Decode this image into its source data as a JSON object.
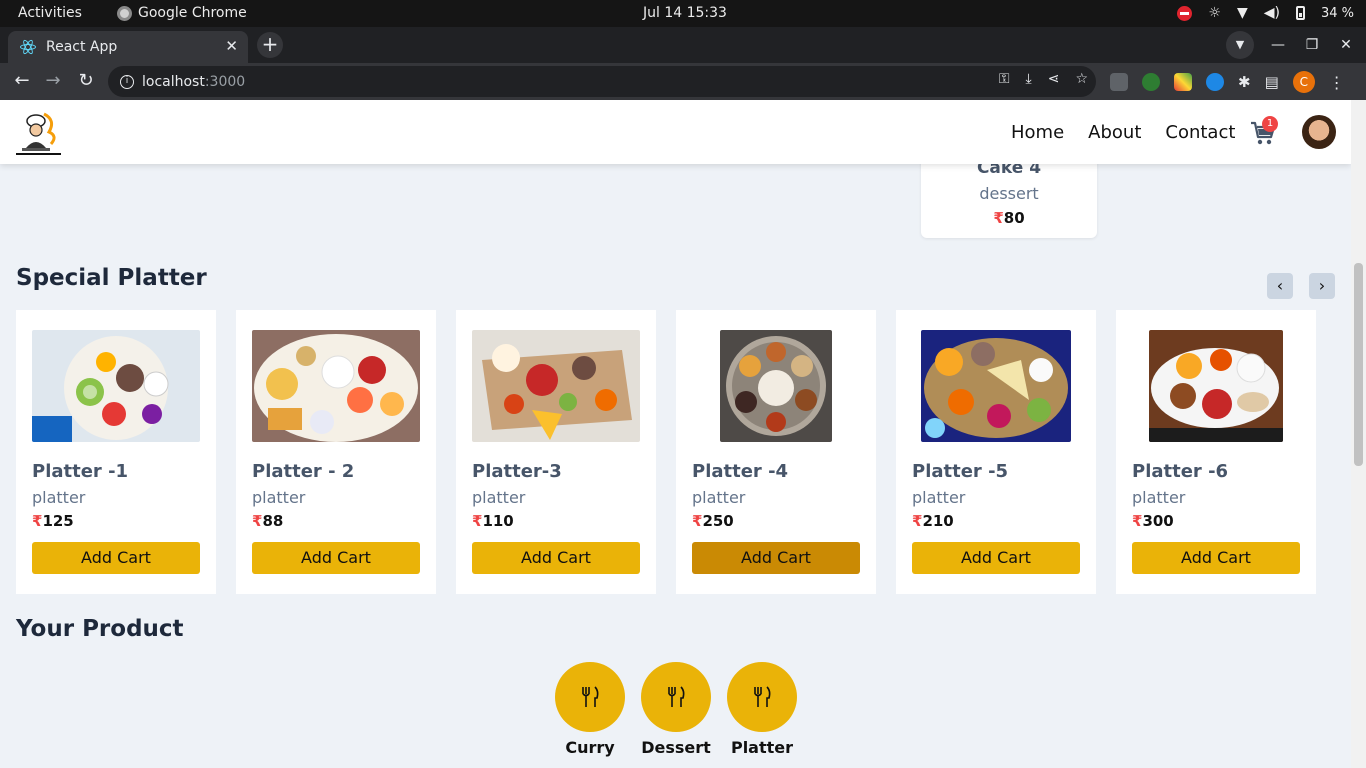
{
  "system_bar": {
    "activities": "Activities",
    "app_name": "Google Chrome",
    "datetime": "Jul 14  15:33",
    "battery": "34 %"
  },
  "browser": {
    "tab_title": "React App",
    "url_host": "localhost",
    "url_port": ":3000",
    "profile_initial": "C"
  },
  "header": {
    "nav": [
      "Home",
      "About",
      "Contact"
    ],
    "cart_count": "1"
  },
  "previous_card": {
    "name": "Cake 4",
    "category": "dessert",
    "currency": "₹",
    "price": "80"
  },
  "special_section": {
    "title": "Special Platter",
    "prev_arrow": "‹",
    "next_arrow": "›",
    "add_label": "Add Cart",
    "currency": "₹",
    "items": [
      {
        "name": "Platter -1",
        "category": "platter",
        "price": "125"
      },
      {
        "name": "Platter - 2",
        "category": "platter",
        "price": "88"
      },
      {
        "name": "Platter-3",
        "category": "platter",
        "price": "110"
      },
      {
        "name": "Platter -4",
        "category": "platter",
        "price": "250"
      },
      {
        "name": "Platter -5",
        "category": "platter",
        "price": "210"
      },
      {
        "name": "Platter -6",
        "category": "platter",
        "price": "300"
      }
    ]
  },
  "your_product": {
    "title": "Your Product",
    "categories": [
      "Curry",
      "Dessert",
      "Platter"
    ]
  },
  "colors": {
    "accent": "#eab308",
    "accent_hover": "#ca8a04",
    "rupee": "#ef4444"
  }
}
